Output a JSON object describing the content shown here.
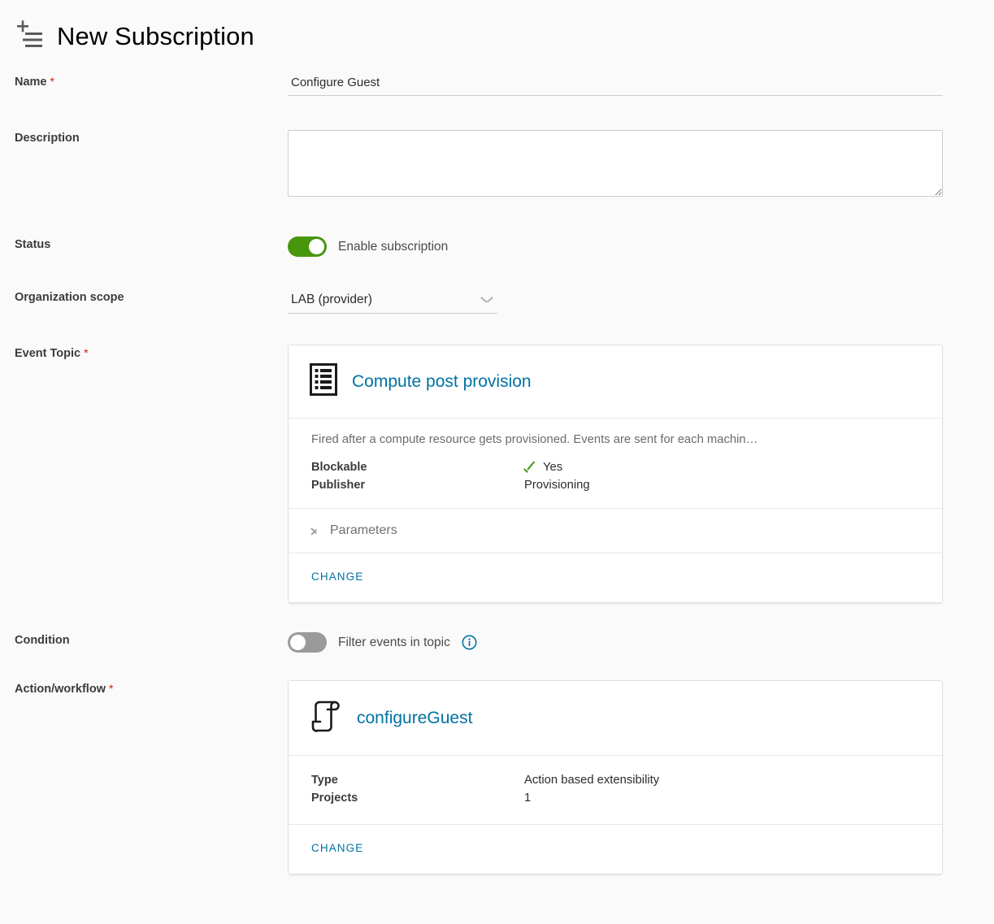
{
  "header": {
    "icon": "add-to-list-icon",
    "title": "New Subscription"
  },
  "form": {
    "name": {
      "label": "Name",
      "required_marker": "*",
      "value": "Configure Guest",
      "placeholder": ""
    },
    "description": {
      "label": "Description",
      "value": "",
      "placeholder": ""
    },
    "status": {
      "label": "Status",
      "toggle_state": "on",
      "toggle_label": "Enable subscription"
    },
    "organization_scope": {
      "label": "Organization scope",
      "selected": "LAB (provider)",
      "icon": "chevron-down-icon"
    },
    "event_topic": {
      "label": "Event Topic",
      "required_marker": "*",
      "icon": "document-list-icon",
      "title": "Compute post provision",
      "description": "Fired after a compute resource gets provisioned. Events are sent for each machin…",
      "details": [
        {
          "key": "Blockable",
          "value": "Yes",
          "icon": "check-icon"
        },
        {
          "key": "Publisher",
          "value": "Provisioning",
          "icon": ""
        }
      ],
      "parameters_label": "Parameters",
      "parameters_icon": "chevron-right-icon",
      "change_label": "CHANGE"
    },
    "condition": {
      "label": "Condition",
      "toggle_state": "off",
      "toggle_label": "Filter events in topic",
      "info_icon": "info-circle-icon"
    },
    "action_workflow": {
      "label": "Action/workflow",
      "required_marker": "*",
      "icon": "script-scroll-icon",
      "title": "configureGuest",
      "details": [
        {
          "key": "Type",
          "value": "Action based extensibility"
        },
        {
          "key": "Projects",
          "value": "1"
        }
      ],
      "change_label": "CHANGE"
    }
  },
  "colors": {
    "link": "#0072a3",
    "toggle_on": "#48960c",
    "toggle_off": "#9a9a9a",
    "required": "#c92100",
    "check": "#3a9410",
    "page_bg": "#fafafa"
  }
}
